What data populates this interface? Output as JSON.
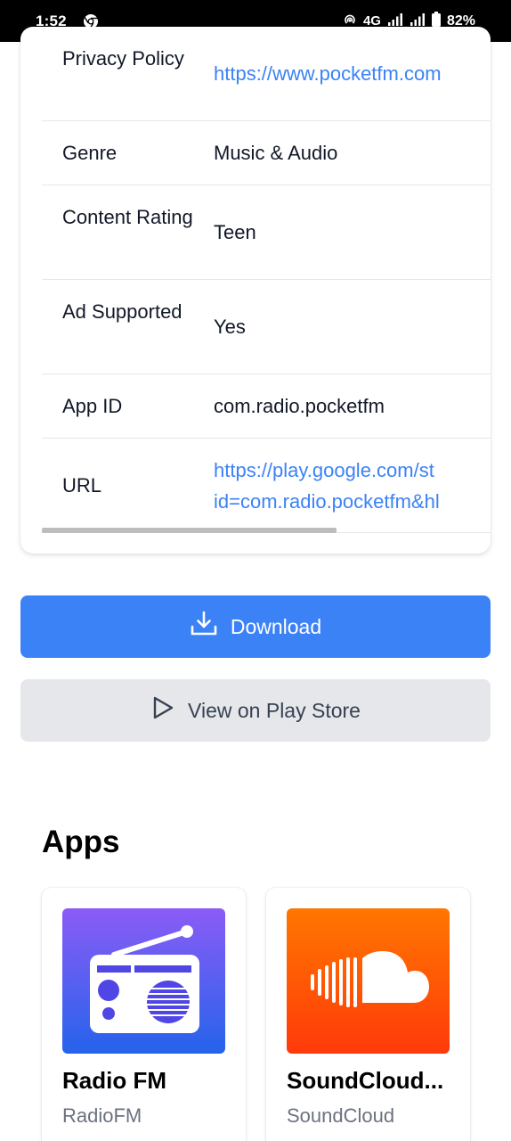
{
  "status_bar": {
    "time": "1:52",
    "network": "4G",
    "battery": "82%"
  },
  "details": [
    {
      "key": "Privacy Policy",
      "value": "https://www.pocketfm.com",
      "link": true
    },
    {
      "key": "Genre",
      "value": "Music & Audio",
      "link": false
    },
    {
      "key": "Content Rating",
      "value": "Teen",
      "link": false
    },
    {
      "key": "Ad Supported",
      "value": "Yes",
      "link": false
    },
    {
      "key": "App ID",
      "value": "com.radio.pocketfm",
      "link": false
    },
    {
      "key": "URL",
      "value": "https://play.google.com/store/apps/details?id=com.radio.pocketfm&hl",
      "value_line1": "https://play.google.com/st",
      "value_line2": "id=com.radio.pocketfm&hl",
      "link": true
    }
  ],
  "buttons": {
    "download": "Download",
    "play_store": "View on Play Store"
  },
  "apps_section": {
    "title": "Apps",
    "items": [
      {
        "name": "Radio FM",
        "developer": "RadioFM",
        "icon": "radio-icon"
      },
      {
        "name": "SoundCloud...",
        "developer": "SoundCloud",
        "icon": "soundcloud-icon"
      }
    ]
  },
  "colors": {
    "primary": "#3b82f6",
    "link": "#3b82f6",
    "secondary_button": "#e5e7eb"
  }
}
